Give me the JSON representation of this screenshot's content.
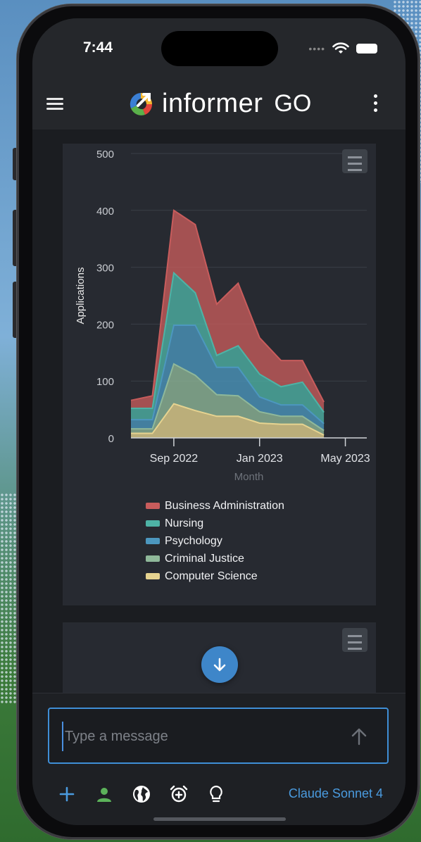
{
  "status_bar": {
    "time": "7:44"
  },
  "header": {
    "app_name": "informer",
    "app_suffix": "GO"
  },
  "chart_data": {
    "type": "area",
    "stacked": true,
    "xlabel": "Month",
    "ylabel": "Applications",
    "ylim": [
      0,
      500
    ],
    "yticks": [
      0,
      100,
      200,
      300,
      400,
      500
    ],
    "x": [
      "2022-07",
      "2022-08",
      "2022-09",
      "2022-10",
      "2022-11",
      "2022-12",
      "2023-01",
      "2023-02",
      "2023-03",
      "2023-04",
      "2023-05",
      "2023-06"
    ],
    "xtick_labels": [
      {
        "label": "Sep 2022",
        "x": "2022-09"
      },
      {
        "label": "Jan 2023",
        "x": "2023-01"
      },
      {
        "label": "May 2023",
        "x": "2023-05"
      }
    ],
    "legend_position": "bottom",
    "series": [
      {
        "name": "Computer Science",
        "color": "#e6d390",
        "values": [
          8,
          8,
          60,
          48,
          38,
          38,
          26,
          24,
          24,
          5
        ]
      },
      {
        "name": "Criminal Justice",
        "color": "#8fb89a",
        "values": [
          8,
          8,
          70,
          62,
          38,
          36,
          20,
          14,
          14,
          8
        ]
      },
      {
        "name": "Psychology",
        "color": "#4c97bf",
        "values": [
          16,
          16,
          68,
          88,
          48,
          50,
          26,
          20,
          20,
          12
        ]
      },
      {
        "name": "Nursing",
        "color": "#4eb3a6",
        "values": [
          20,
          20,
          92,
          57,
          21,
          38,
          40,
          32,
          40,
          20
        ]
      },
      {
        "name": "Business Administration",
        "color": "#c85c5c",
        "values": [
          14,
          22,
          110,
          120,
          90,
          110,
          64,
          46,
          38,
          18
        ]
      }
    ],
    "legend": [
      "Business Administration",
      "Nursing",
      "Psychology",
      "Criminal Justice",
      "Computer Science"
    ]
  },
  "composer": {
    "placeholder": "Type a message",
    "model_label": "Claude Sonnet 4"
  },
  "toolbar": {
    "icons": [
      "plus-icon",
      "person-icon",
      "globe-icon",
      "alarm-add-icon",
      "lightbulb-icon"
    ]
  },
  "colors": {
    "accent": "#3f8ed6",
    "fab": "#3e86c9",
    "background": "#1b1d21"
  }
}
